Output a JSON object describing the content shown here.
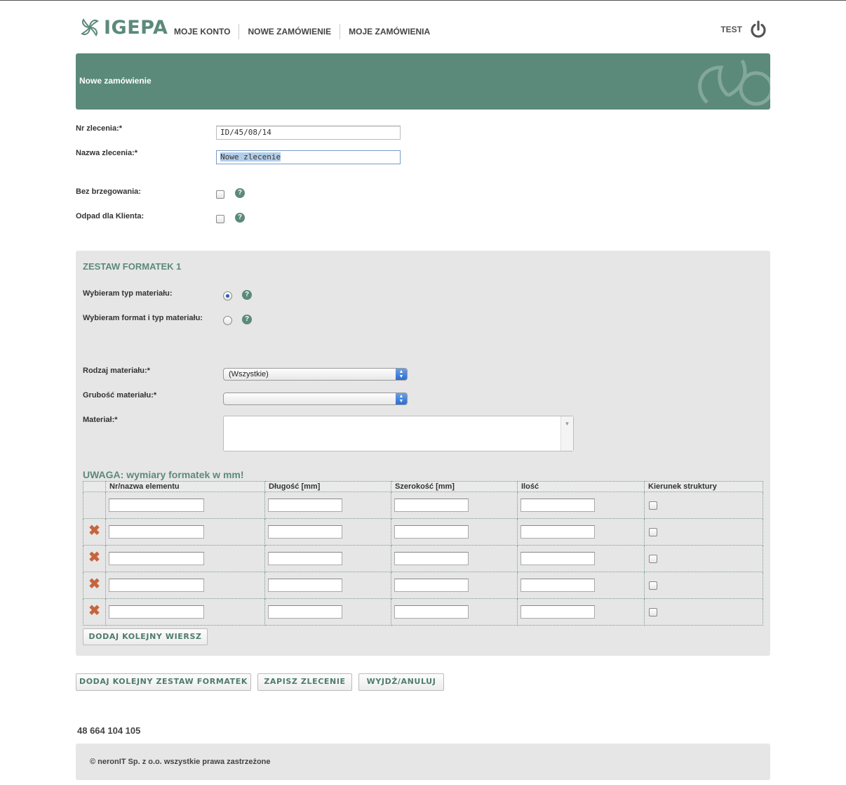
{
  "header": {
    "logo_text": "IGEPA",
    "nav": [
      "MOJE KONTO",
      "NOWE ZAMÓWIENIE",
      "MOJE ZAMÓWIENIA"
    ],
    "user": "TEST"
  },
  "banner": {
    "title": "Nowe zamówienie"
  },
  "form": {
    "order_number_label": "Nr zlecenia:*",
    "order_number_value": "ID/45/08/14",
    "order_name_label": "Nazwa zlecenia:*",
    "order_name_value": "Nowe zlecenie",
    "no_edging_label": "Bez brzegowania:",
    "waste_label": "Odpad dla Klienta:",
    "help_glyph": "?"
  },
  "panel": {
    "title": "ZESTAW FORMATEK 1",
    "radio_material_type_label": "Wybieram typ materiału:",
    "radio_format_type_label": "Wybieram format i typ materiału:",
    "material_kind_label": "Rodzaj materiału:*",
    "material_kind_value": "(Wszystkie)",
    "material_thickness_label": "Grubość materiału:*",
    "material_thickness_value": "",
    "material_label": "Materiał:*",
    "warning": "UWAGA: wymiary formatek w mm!",
    "table_headers": [
      "",
      "Nr/nazwa elementu",
      "Długość [mm]",
      "Szerokość [mm]",
      "Ilość",
      "Kierunek struktury"
    ],
    "delete_glyph": "✖",
    "add_row_button": "DODAJ KOLEJNY WIERSZ"
  },
  "buttons": {
    "add_set": "DODAJ KOLEJNY ZESTAW FORMATEK",
    "save": "ZAPISZ ZLECENIE",
    "exit": "WYJDŹ/ANULUJ"
  },
  "phone": "48 664 104 105",
  "footer": {
    "copyright": "© neronIT Sp. z o.o. wszystkie prawa zastrzeżone"
  },
  "colors": {
    "brand_green": "#5b8a7a",
    "panel_gray": "#e6e6e6",
    "delete_orange": "#c8643c"
  }
}
